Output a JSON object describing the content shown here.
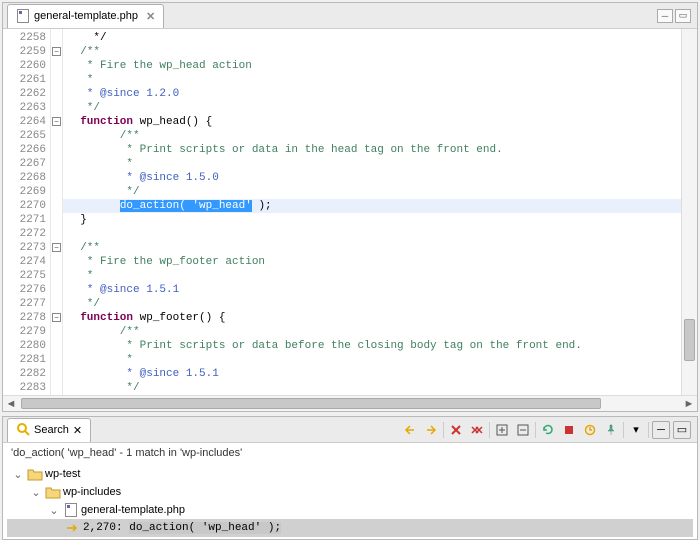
{
  "editor": {
    "tab_label": "general-template.php",
    "lines": [
      {
        "n": 2258,
        "t": "    */"
      },
      {
        "n": 2259,
        "t": "  /**",
        "fold": "open",
        "cls": "cm"
      },
      {
        "n": 2260,
        "t": "   * Fire the wp_head action",
        "cls": "cm"
      },
      {
        "n": 2261,
        "t": "   *",
        "cls": "cm"
      },
      {
        "n": 2262,
        "t": "   * @since 1.2.0",
        "cls": "cmtag"
      },
      {
        "n": 2263,
        "t": "   */",
        "cls": "cm"
      },
      {
        "n": 2264,
        "kw": "function",
        "fnname": " wp_head() {",
        "fold": "open"
      },
      {
        "n": 2265,
        "t": "        /**",
        "cls": "cm"
      },
      {
        "n": 2266,
        "t": "         * Print scripts or data in the head tag on the front end.",
        "cls": "cm"
      },
      {
        "n": 2267,
        "t": "         *",
        "cls": "cm"
      },
      {
        "n": 2268,
        "t": "         * @since 1.5.0",
        "cls": "cmtag"
      },
      {
        "n": 2269,
        "t": "         */",
        "cls": "cm"
      },
      {
        "n": 2270,
        "pre": "        ",
        "sel": "do_action( 'wp_head'",
        "post": " );",
        "hl": true
      },
      {
        "n": 2271,
        "t": "  }"
      },
      {
        "n": 2272,
        "t": ""
      },
      {
        "n": 2273,
        "t": "  /**",
        "fold": "open",
        "cls": "cm"
      },
      {
        "n": 2274,
        "t": "   * Fire the wp_footer action",
        "cls": "cm"
      },
      {
        "n": 2275,
        "t": "   *",
        "cls": "cm"
      },
      {
        "n": 2276,
        "t": "   * @since 1.5.1",
        "cls": "cmtag"
      },
      {
        "n": 2277,
        "t": "   */",
        "cls": "cm"
      },
      {
        "n": 2278,
        "kw": "function",
        "fnname": " wp_footer() {",
        "fold": "open"
      },
      {
        "n": 2279,
        "t": "        /**",
        "cls": "cm"
      },
      {
        "n": 2280,
        "t": "         * Print scripts or data before the closing body tag on the front end.",
        "cls": "cm"
      },
      {
        "n": 2281,
        "t": "         *",
        "cls": "cm"
      },
      {
        "n": 2282,
        "t": "         * @since 1.5.1",
        "cls": "cmtag"
      },
      {
        "n": 2283,
        "t": "         */",
        "cls": "cm"
      }
    ]
  },
  "search": {
    "tab_label": "Search",
    "summary": "'do_action( 'wp_head' - 1 match in 'wp-includes'",
    "tree": {
      "root": "wp-test",
      "folder": "wp-includes",
      "file": "general-template.php",
      "match_line": "2,270:",
      "match_code_pre": "",
      "match_code_hl": "do_action( 'wp_head' );",
      "match_code_post": ""
    }
  }
}
